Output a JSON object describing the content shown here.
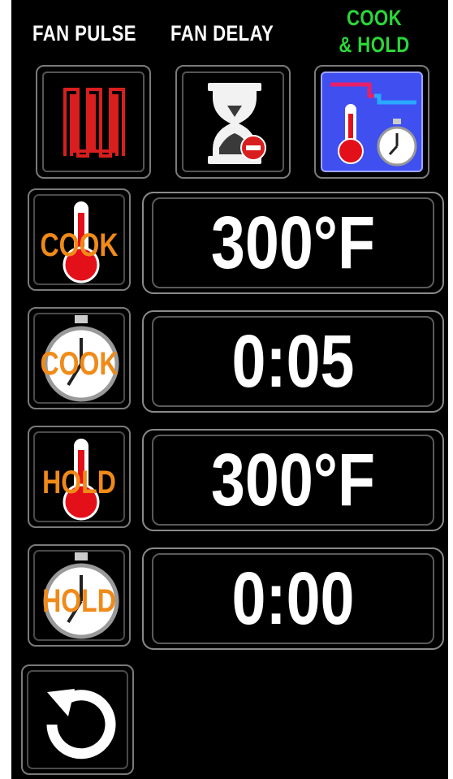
{
  "header": {
    "fan_pulse": "FAN PULSE",
    "fan_delay": "FAN DELAY",
    "cook_hold_line1": "COOK",
    "cook_hold_line2": "& HOLD"
  },
  "colors": {
    "background": "#000000",
    "label_orange": "#f08a18",
    "active_green": "#2bd63a",
    "active_blue": "#3f4ff0",
    "pulse_red": "#d81e1e"
  },
  "modes": [
    {
      "name": "fan-pulse",
      "icon": "pulse-wave-icon",
      "active": false
    },
    {
      "name": "fan-delay",
      "icon": "hourglass-icon",
      "active": false
    },
    {
      "name": "cook-and-hold",
      "icon": "thermometer-timer-icon",
      "active": true
    }
  ],
  "rows": [
    {
      "icon": "thermometer-icon",
      "overlay": "COOK",
      "value": "300°F"
    },
    {
      "icon": "stopwatch-icon",
      "overlay": "COOK",
      "value": "0:05"
    },
    {
      "icon": "thermometer-icon",
      "overlay": "HOLD",
      "value": "300°F"
    },
    {
      "icon": "stopwatch-icon",
      "overlay": "HOLD",
      "value": "0:00"
    }
  ],
  "reset": {
    "icon": "reset-icon"
  }
}
